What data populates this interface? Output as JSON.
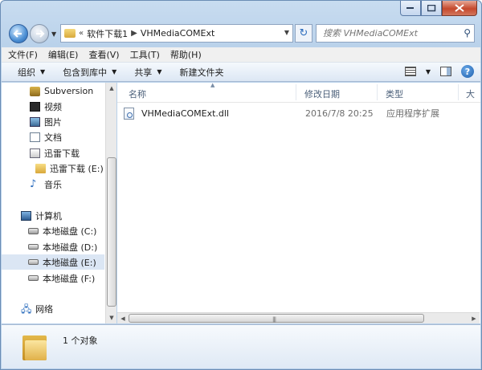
{
  "window": {
    "caption_buttons": [
      "minimize",
      "maximize",
      "close"
    ]
  },
  "address": {
    "overflow": "«",
    "crumbs": [
      "软件下载1",
      "VHMediaCOMExt"
    ],
    "search_placeholder": "搜索 VHMediaCOMExt"
  },
  "menu": [
    "文件(F)",
    "编辑(E)",
    "查看(V)",
    "工具(T)",
    "帮助(H)"
  ],
  "commands": {
    "organize": "组织",
    "include_library": "包含到库中",
    "share": "共享",
    "new_folder": "新建文件夹"
  },
  "nav": {
    "items": [
      {
        "label": "Subversion",
        "icon": "subversion-icon"
      },
      {
        "label": "视频",
        "icon": "video-icon"
      },
      {
        "label": "图片",
        "icon": "pictures-icon"
      },
      {
        "label": "文档",
        "icon": "documents-icon"
      },
      {
        "label": "迅雷下载",
        "icon": "download-icon"
      },
      {
        "label": "迅雷下载 (E:)",
        "icon": "folder-icon"
      },
      {
        "label": "音乐",
        "icon": "music-icon"
      },
      {
        "label": "计算机",
        "icon": "computer-icon"
      },
      {
        "label": "本地磁盘 (C:)",
        "icon": "system-drive-icon"
      },
      {
        "label": "本地磁盘 (D:)",
        "icon": "drive-icon"
      },
      {
        "label": "本地磁盘 (E:)",
        "icon": "drive-icon",
        "selected": true
      },
      {
        "label": "本地磁盘 (F:)",
        "icon": "drive-icon"
      },
      {
        "label": "网络",
        "icon": "network-icon"
      }
    ]
  },
  "columns": {
    "name": "名称",
    "modified": "修改日期",
    "type": "类型",
    "size": "大"
  },
  "files": [
    {
      "name": "VHMediaCOMExt.dll",
      "modified": "2016/7/8 20:25",
      "type": "应用程序扩展"
    }
  ],
  "details": {
    "count": "1 个对象"
  },
  "colors": {
    "frame": "#b9d1ea",
    "selection": "#dbe6f4",
    "column_text": "#4c607a"
  }
}
